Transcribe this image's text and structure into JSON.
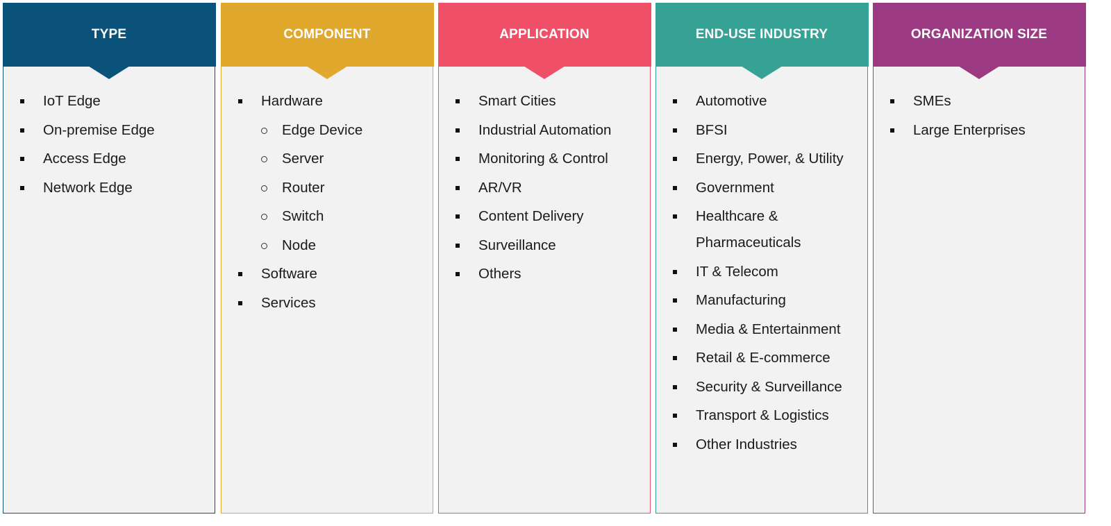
{
  "columns": [
    {
      "title": "TYPE",
      "color": "#0b527b",
      "items": [
        {
          "label": "IoT Edge",
          "level": 1
        },
        {
          "label": "On-premise Edge",
          "level": 1
        },
        {
          "label": "Access Edge",
          "level": 1
        },
        {
          "label": "Network Edge",
          "level": 1
        }
      ]
    },
    {
      "title": "COMPONENT",
      "color": "#e0a82c",
      "items": [
        {
          "label": "Hardware",
          "level": 1
        },
        {
          "label": "Edge Device",
          "level": 2
        },
        {
          "label": "Server",
          "level": 2
        },
        {
          "label": "Router",
          "level": 2
        },
        {
          "label": "Switch",
          "level": 2
        },
        {
          "label": "Node",
          "level": 2
        },
        {
          "label": "Software",
          "level": 1
        },
        {
          "label": "Services",
          "level": 1
        }
      ]
    },
    {
      "title": "APPLICATION",
      "color": "#ef4f67",
      "items": [
        {
          "label": "Smart Cities",
          "level": 1
        },
        {
          "label": "Industrial Automation",
          "level": 1
        },
        {
          "label": "Monitoring & Control",
          "level": 1
        },
        {
          "label": "AR/VR",
          "level": 1
        },
        {
          "label": "Content Delivery",
          "level": 1
        },
        {
          "label": "Surveillance",
          "level": 1
        },
        {
          "label": "Others",
          "level": 1
        }
      ]
    },
    {
      "title": "END-USE INDUSTRY",
      "color": "#36a195",
      "items": [
        {
          "label": "Automotive",
          "level": 1
        },
        {
          "label": "BFSI",
          "level": 1
        },
        {
          "label": "Energy, Power, & Utility",
          "level": 1
        },
        {
          "label": "Government",
          "level": 1
        },
        {
          "label": "Healthcare & Pharmaceuticals",
          "level": 1
        },
        {
          "label": "IT & Telecom",
          "level": 1
        },
        {
          "label": "Manufacturing",
          "level": 1
        },
        {
          "label": "Media & Entertainment",
          "level": 1
        },
        {
          "label": "Retail & E-commerce",
          "level": 1
        },
        {
          "label": "Security & Surveillance",
          "level": 1
        },
        {
          "label": "Transport & Logistics",
          "level": 1
        },
        {
          "label": "Other Industries",
          "level": 1
        }
      ]
    },
    {
      "title": "ORGANIZATION SIZE",
      "color": "#9b3a82",
      "items": [
        {
          "label": "SMEs",
          "level": 1
        },
        {
          "label": "Large Enterprises",
          "level": 1
        }
      ]
    }
  ]
}
